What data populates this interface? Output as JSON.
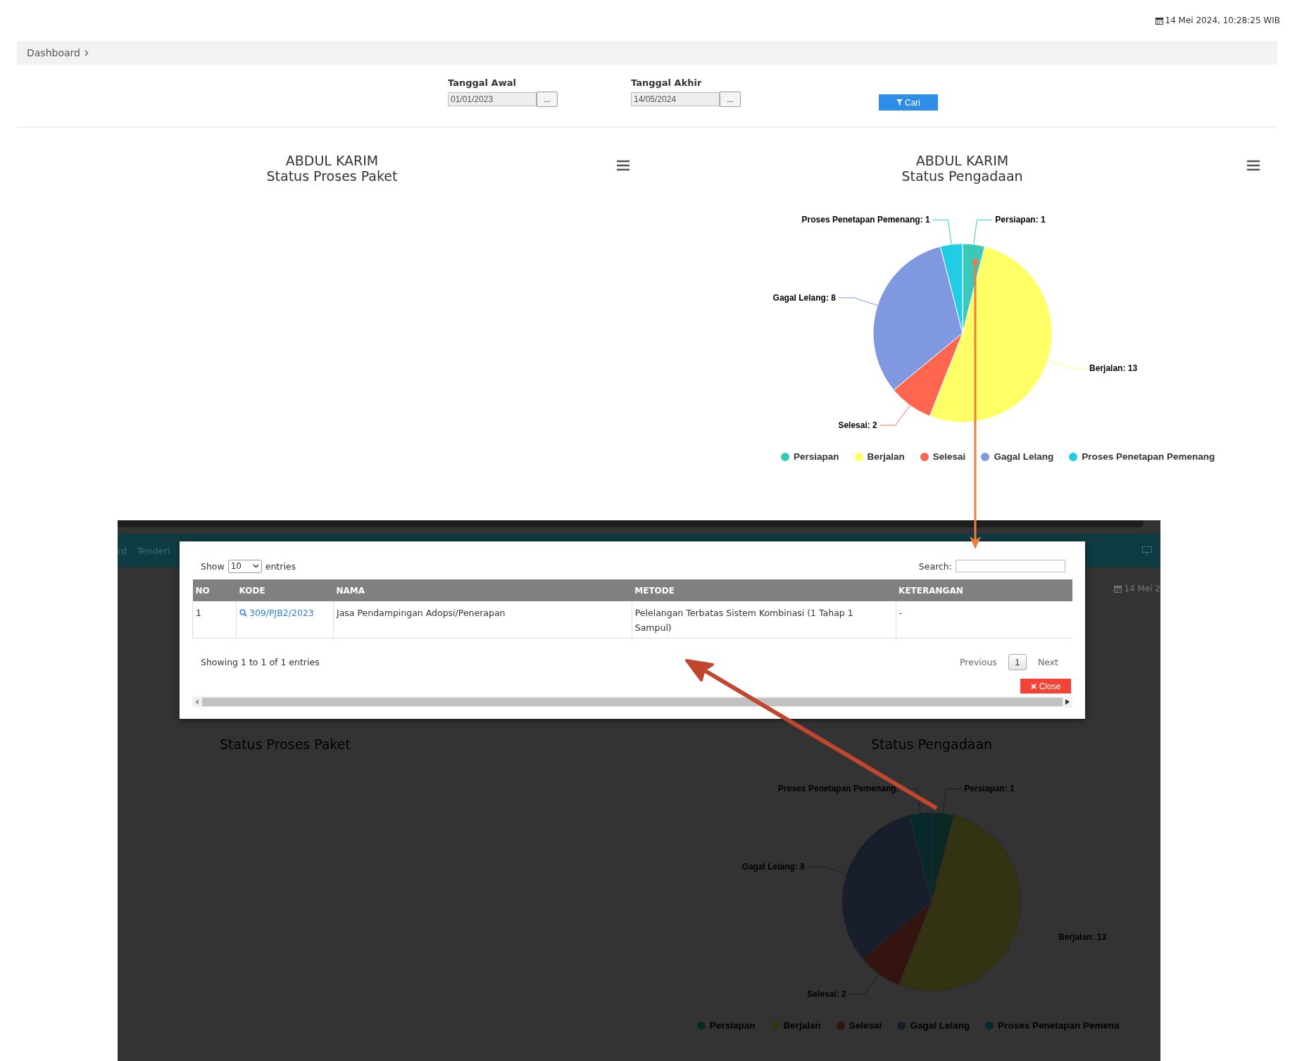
{
  "datetime": "14 Mei 2024, 10:28:25 WIB",
  "breadcrumb": [
    "Dashboard"
  ],
  "filters": [
    {
      "label": "Tanggal Awal",
      "value": "01/01/2023",
      "button": "..."
    },
    {
      "label": "Tanggal Akhir",
      "value": "14/05/2024",
      "button": "..."
    }
  ],
  "search_button": "Cari",
  "charts": [
    {
      "title": "ABDUL KARIM",
      "subtitle": "Status Proses Paket"
    },
    {
      "title": "ABDUL KARIM",
      "subtitle": "Status Pengadaan",
      "chart_data": {
        "type": "pie",
        "categories": [
          "Persiapan",
          "Berjalan",
          "Selesai",
          "Gagal Lelang",
          "Proses Penetapan Pemenang"
        ],
        "values": [
          1,
          13,
          2,
          8,
          1
        ],
        "value_labels": [
          "Persiapan: 1",
          "Berjalan: 13",
          "Selesai: 2",
          "Gagal Lelang: 8",
          "Proses Penetapan Pemenang: 1"
        ]
      },
      "legend": [
        {
          "color": "#3ac8b8"
        },
        {
          "color": "#ffff66"
        },
        {
          "color": "#ff6650"
        },
        {
          "color": "#7f98e0"
        },
        {
          "color": "#22cce4"
        }
      ]
    }
  ],
  "inset": {
    "nav_items": [
      "rd",
      "Tenderi"
    ],
    "datetime": "14 Mei 2",
    "charts": [
      {
        "subtitle": "Status Proses Paket"
      },
      {
        "subtitle": "Status Pengadaan",
        "chart_data": {
          "type": "pie",
          "categories": [
            "Persiapan",
            "Berjalan",
            "Selesai",
            "Gagal Lelang",
            "Proses Penetapan Pemena"
          ],
          "values": [
            1,
            13,
            2,
            8,
            1
          ],
          "value_labels": [
            "Persiapan: 1",
            "Berjalan: 13",
            "Selesai: 2",
            "Gagal Lelang: 8",
            "Proses Penetapan Pemenang:"
          ]
        },
        "legend": [
          {
            "color": "#0c2825"
          },
          {
            "color": "#333314"
          },
          {
            "color": "#331410"
          },
          {
            "color": "#191e2d"
          },
          {
            "color": "#07292e"
          }
        ]
      }
    ]
  },
  "modal": {
    "show_label": "Show",
    "page_length": "10",
    "entries_label": "entries",
    "search_label": "Search:",
    "columns": [
      "NO",
      "KODE",
      "NAMA",
      "METODE",
      "KETERANGAN"
    ],
    "rows": [
      [
        "1",
        "309/PJB2/2023",
        "Jasa Pendampingan Adopsi/Penerapan",
        "Pelelangan Terbatas Sistem Kombinasi (1 Tahap 1 Sampul)",
        "-"
      ]
    ],
    "info": "Showing 1 to 1 of 1 entries",
    "previous": "Previous",
    "pages": [
      {
        "label": "1",
        "selected": true
      }
    ],
    "next": "Next",
    "close_button": "Close"
  }
}
